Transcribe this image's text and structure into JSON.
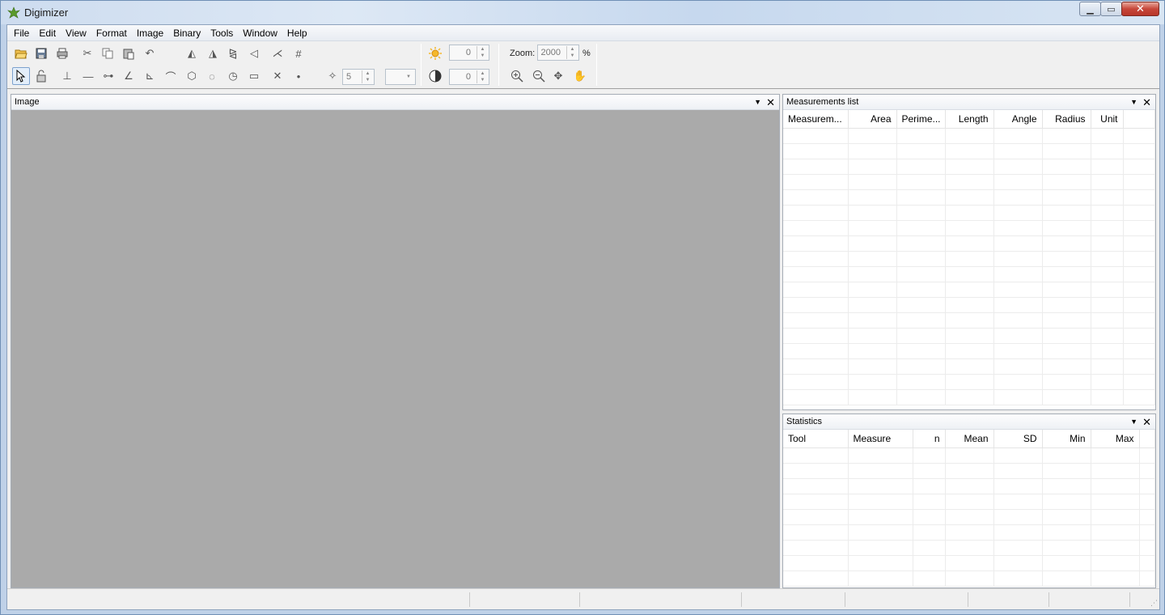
{
  "window": {
    "title": "Digimizer"
  },
  "menu": [
    "File",
    "Edit",
    "View",
    "Format",
    "Image",
    "Binary",
    "Tools",
    "Window",
    "Help"
  ],
  "toolbar": {
    "brush_size": "5",
    "brightness": "0",
    "contrast": "0",
    "zoom_label": "Zoom:",
    "zoom_value": "2000",
    "zoom_unit": "%"
  },
  "panels": {
    "image": {
      "title": "Image"
    },
    "measurements": {
      "title": "Measurements list",
      "columns": [
        "Measurem...",
        "Area",
        "Perime...",
        "Length",
        "Angle",
        "Radius",
        "Unit"
      ]
    },
    "statistics": {
      "title": "Statistics",
      "columns": [
        "Tool",
        "Measure",
        "n",
        "Mean",
        "SD",
        "Min",
        "Max"
      ]
    }
  },
  "icons": {
    "app": "leaf-icon",
    "brightness": "sun-icon",
    "contrast": "contrast-icon"
  },
  "colors": {
    "image_canvas": "#aaaaaa",
    "close_button": "#c7473a"
  }
}
